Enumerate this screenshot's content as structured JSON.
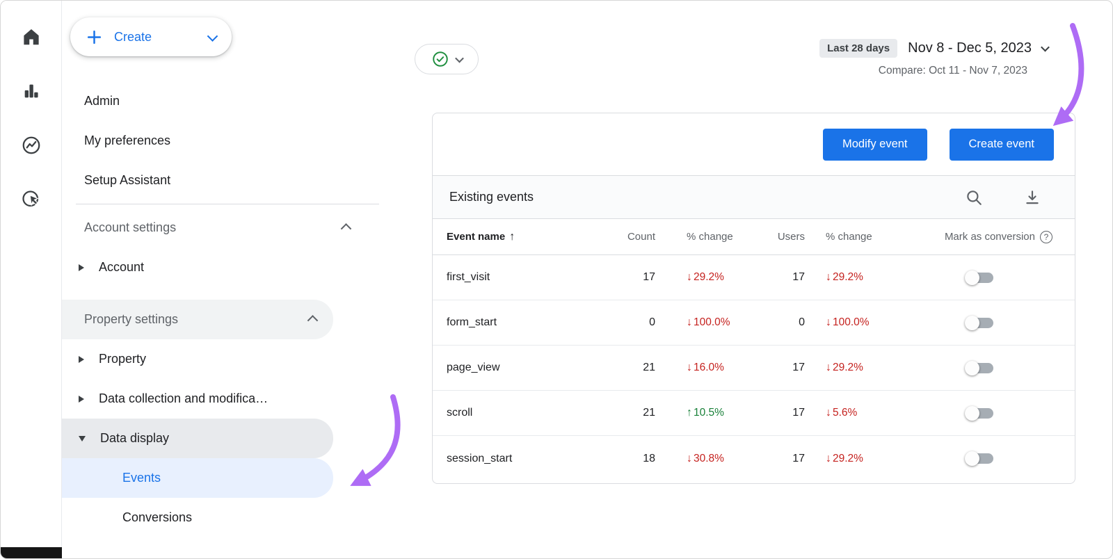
{
  "colors": {
    "primary_blue": "#1a73e8",
    "selected_nav_bg": "#e8f0fe",
    "negative_red": "#c5221f",
    "positive_green": "#188038",
    "annotation_purple": "#ae6cf5"
  },
  "icon_rail": {
    "items": [
      "home-icon",
      "reports-icon",
      "explore-icon",
      "advertising-icon"
    ]
  },
  "nav": {
    "create_button": {
      "label": "Create"
    },
    "items": [
      {
        "label": "Admin"
      },
      {
        "label": "My preferences"
      },
      {
        "label": "Setup Assistant"
      },
      {
        "label": "Account settings",
        "chevron": "up"
      },
      {
        "label": "Account",
        "expander": "collapsed"
      },
      {
        "label": "Property settings",
        "chevron": "up"
      },
      {
        "label": "Property",
        "expander": "collapsed"
      },
      {
        "label": "Data collection and modifica…",
        "expander": "collapsed"
      },
      {
        "label": "Data display",
        "expander": "expanded"
      },
      {
        "label": "Events",
        "selected": true
      },
      {
        "label": "Conversions"
      }
    ]
  },
  "header": {
    "date_preset": "Last 28 days",
    "date_range": "Nov 8 - Dec 5, 2023",
    "compare": "Compare: Oct 11 - Nov 7, 2023"
  },
  "main": {
    "modify_event_label": "Modify event",
    "create_event_label": "Create event",
    "section_title": "Existing events",
    "table": {
      "headers": {
        "event_name": "Event name",
        "count": "Count",
        "count_change": "% change",
        "users": "Users",
        "users_change": "% change",
        "conversion": "Mark as conversion"
      },
      "rows": [
        {
          "name": "first_visit",
          "count": "17",
          "count_change": "29.2%",
          "count_dir": "down",
          "users": "17",
          "users_change": "29.2%",
          "users_dir": "down",
          "toggle": "off"
        },
        {
          "name": "form_start",
          "count": "0",
          "count_change": "100.0%",
          "count_dir": "down",
          "users": "0",
          "users_change": "100.0%",
          "users_dir": "down",
          "toggle": "off"
        },
        {
          "name": "page_view",
          "count": "21",
          "count_change": "16.0%",
          "count_dir": "down",
          "users": "17",
          "users_change": "29.2%",
          "users_dir": "down",
          "toggle": "off"
        },
        {
          "name": "scroll",
          "count": "21",
          "count_change": "10.5%",
          "count_dir": "up",
          "users": "17",
          "users_change": "5.6%",
          "users_dir": "down",
          "toggle": "off"
        },
        {
          "name": "session_start",
          "count": "18",
          "count_change": "30.8%",
          "count_dir": "down",
          "users": "17",
          "users_change": "29.2%",
          "users_dir": "down",
          "toggle": "off"
        }
      ]
    }
  }
}
